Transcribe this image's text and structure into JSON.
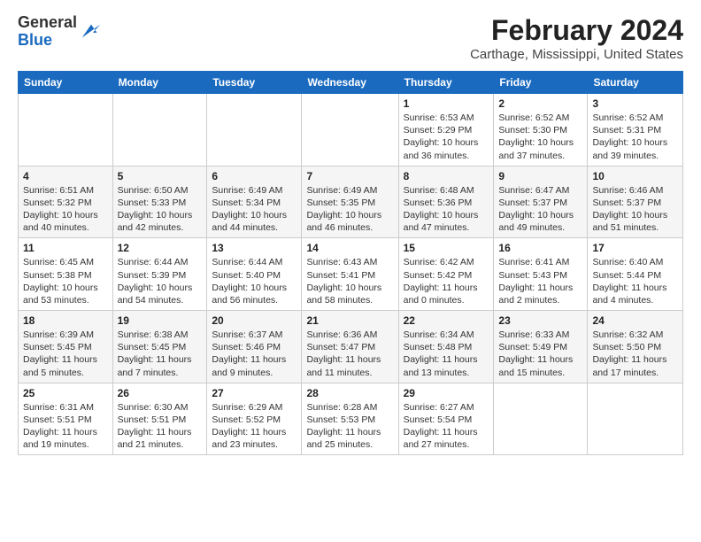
{
  "header": {
    "logo_line1": "General",
    "logo_line2": "Blue",
    "title": "February 2024",
    "subtitle": "Carthage, Mississippi, United States"
  },
  "days_of_week": [
    "Sunday",
    "Monday",
    "Tuesday",
    "Wednesday",
    "Thursday",
    "Friday",
    "Saturday"
  ],
  "weeks": [
    [
      {
        "day": "",
        "detail": ""
      },
      {
        "day": "",
        "detail": ""
      },
      {
        "day": "",
        "detail": ""
      },
      {
        "day": "",
        "detail": ""
      },
      {
        "day": "1",
        "detail": "Sunrise: 6:53 AM\nSunset: 5:29 PM\nDaylight: 10 hours\nand 36 minutes."
      },
      {
        "day": "2",
        "detail": "Sunrise: 6:52 AM\nSunset: 5:30 PM\nDaylight: 10 hours\nand 37 minutes."
      },
      {
        "day": "3",
        "detail": "Sunrise: 6:52 AM\nSunset: 5:31 PM\nDaylight: 10 hours\nand 39 minutes."
      }
    ],
    [
      {
        "day": "4",
        "detail": "Sunrise: 6:51 AM\nSunset: 5:32 PM\nDaylight: 10 hours\nand 40 minutes."
      },
      {
        "day": "5",
        "detail": "Sunrise: 6:50 AM\nSunset: 5:33 PM\nDaylight: 10 hours\nand 42 minutes."
      },
      {
        "day": "6",
        "detail": "Sunrise: 6:49 AM\nSunset: 5:34 PM\nDaylight: 10 hours\nand 44 minutes."
      },
      {
        "day": "7",
        "detail": "Sunrise: 6:49 AM\nSunset: 5:35 PM\nDaylight: 10 hours\nand 46 minutes."
      },
      {
        "day": "8",
        "detail": "Sunrise: 6:48 AM\nSunset: 5:36 PM\nDaylight: 10 hours\nand 47 minutes."
      },
      {
        "day": "9",
        "detail": "Sunrise: 6:47 AM\nSunset: 5:37 PM\nDaylight: 10 hours\nand 49 minutes."
      },
      {
        "day": "10",
        "detail": "Sunrise: 6:46 AM\nSunset: 5:37 PM\nDaylight: 10 hours\nand 51 minutes."
      }
    ],
    [
      {
        "day": "11",
        "detail": "Sunrise: 6:45 AM\nSunset: 5:38 PM\nDaylight: 10 hours\nand 53 minutes."
      },
      {
        "day": "12",
        "detail": "Sunrise: 6:44 AM\nSunset: 5:39 PM\nDaylight: 10 hours\nand 54 minutes."
      },
      {
        "day": "13",
        "detail": "Sunrise: 6:44 AM\nSunset: 5:40 PM\nDaylight: 10 hours\nand 56 minutes."
      },
      {
        "day": "14",
        "detail": "Sunrise: 6:43 AM\nSunset: 5:41 PM\nDaylight: 10 hours\nand 58 minutes."
      },
      {
        "day": "15",
        "detail": "Sunrise: 6:42 AM\nSunset: 5:42 PM\nDaylight: 11 hours\nand 0 minutes."
      },
      {
        "day": "16",
        "detail": "Sunrise: 6:41 AM\nSunset: 5:43 PM\nDaylight: 11 hours\nand 2 minutes."
      },
      {
        "day": "17",
        "detail": "Sunrise: 6:40 AM\nSunset: 5:44 PM\nDaylight: 11 hours\nand 4 minutes."
      }
    ],
    [
      {
        "day": "18",
        "detail": "Sunrise: 6:39 AM\nSunset: 5:45 PM\nDaylight: 11 hours\nand 5 minutes."
      },
      {
        "day": "19",
        "detail": "Sunrise: 6:38 AM\nSunset: 5:45 PM\nDaylight: 11 hours\nand 7 minutes."
      },
      {
        "day": "20",
        "detail": "Sunrise: 6:37 AM\nSunset: 5:46 PM\nDaylight: 11 hours\nand 9 minutes."
      },
      {
        "day": "21",
        "detail": "Sunrise: 6:36 AM\nSunset: 5:47 PM\nDaylight: 11 hours\nand 11 minutes."
      },
      {
        "day": "22",
        "detail": "Sunrise: 6:34 AM\nSunset: 5:48 PM\nDaylight: 11 hours\nand 13 minutes."
      },
      {
        "day": "23",
        "detail": "Sunrise: 6:33 AM\nSunset: 5:49 PM\nDaylight: 11 hours\nand 15 minutes."
      },
      {
        "day": "24",
        "detail": "Sunrise: 6:32 AM\nSunset: 5:50 PM\nDaylight: 11 hours\nand 17 minutes."
      }
    ],
    [
      {
        "day": "25",
        "detail": "Sunrise: 6:31 AM\nSunset: 5:51 PM\nDaylight: 11 hours\nand 19 minutes."
      },
      {
        "day": "26",
        "detail": "Sunrise: 6:30 AM\nSunset: 5:51 PM\nDaylight: 11 hours\nand 21 minutes."
      },
      {
        "day": "27",
        "detail": "Sunrise: 6:29 AM\nSunset: 5:52 PM\nDaylight: 11 hours\nand 23 minutes."
      },
      {
        "day": "28",
        "detail": "Sunrise: 6:28 AM\nSunset: 5:53 PM\nDaylight: 11 hours\nand 25 minutes."
      },
      {
        "day": "29",
        "detail": "Sunrise: 6:27 AM\nSunset: 5:54 PM\nDaylight: 11 hours\nand 27 minutes."
      },
      {
        "day": "",
        "detail": ""
      },
      {
        "day": "",
        "detail": ""
      }
    ]
  ]
}
